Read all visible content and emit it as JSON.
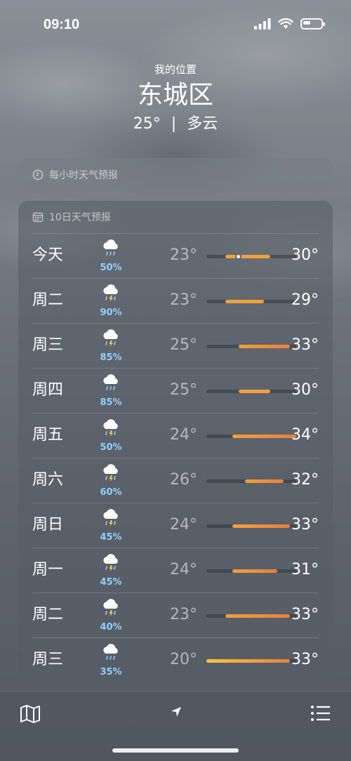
{
  "status": {
    "time": "09:10"
  },
  "header": {
    "location_label": "我的位置",
    "city": "东城区",
    "temperature": "25°",
    "condition": "多云"
  },
  "hourly": {
    "title": "每小时天气预报",
    "icon": "clock-icon"
  },
  "ten_day": {
    "title": "10日天气预报",
    "icon": "calendar-icon",
    "bar_colors": {
      "cool": "#f5c63f",
      "warm": "#f0a13a",
      "hot": "#e8803e"
    },
    "current_temp": 25,
    "days": [
      {
        "day": "今天",
        "icon": "cloud-rain-icon",
        "precip": "50%",
        "low": "23°",
        "high": "30°",
        "low_v": 23,
        "high_v": 30
      },
      {
        "day": "周二",
        "icon": "cloud-bolt-rain-icon",
        "precip": "90%",
        "low": "23°",
        "high": "29°",
        "low_v": 23,
        "high_v": 29
      },
      {
        "day": "周三",
        "icon": "cloud-bolt-rain-icon",
        "precip": "85%",
        "low": "25°",
        "high": "33°",
        "low_v": 25,
        "high_v": 33
      },
      {
        "day": "周四",
        "icon": "cloud-rain-icon",
        "precip": "85%",
        "low": "25°",
        "high": "30°",
        "low_v": 25,
        "high_v": 30
      },
      {
        "day": "周五",
        "icon": "cloud-bolt-rain-icon",
        "precip": "50%",
        "low": "24°",
        "high": "34°",
        "low_v": 24,
        "high_v": 34
      },
      {
        "day": "周六",
        "icon": "cloud-bolt-rain-icon",
        "precip": "60%",
        "low": "26°",
        "high": "32°",
        "low_v": 26,
        "high_v": 32
      },
      {
        "day": "周日",
        "icon": "cloud-bolt-rain-icon",
        "precip": "45%",
        "low": "24°",
        "high": "33°",
        "low_v": 24,
        "high_v": 33
      },
      {
        "day": "周一",
        "icon": "cloud-bolt-rain-icon",
        "precip": "45%",
        "low": "24°",
        "high": "31°",
        "low_v": 24,
        "high_v": 31
      },
      {
        "day": "周二",
        "icon": "cloud-bolt-rain-icon",
        "precip": "40%",
        "low": "23°",
        "high": "33°",
        "low_v": 23,
        "high_v": 33
      },
      {
        "day": "周三",
        "icon": "cloud-rain-icon",
        "precip": "35%",
        "low": "20°",
        "high": "33°",
        "low_v": 20,
        "high_v": 33
      }
    ]
  },
  "tabbar": {
    "map_icon": "map-icon",
    "location_icon": "location-arrow-icon",
    "list_icon": "list-icon"
  }
}
